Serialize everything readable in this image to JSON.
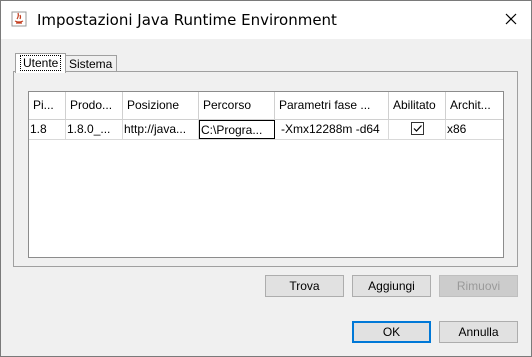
{
  "window": {
    "title": "Impostazioni Java Runtime Environment"
  },
  "tabs": [
    {
      "label": "Utente",
      "active": true
    },
    {
      "label": "Sistema",
      "active": false
    }
  ],
  "table": {
    "columns": [
      "Pi...",
      "Prodo...",
      "Posizione",
      "Percorso",
      "Parametri fase ...",
      "Abilitato",
      "Archit..."
    ],
    "rows": [
      {
        "cells": [
          "1.8",
          "1.8.0_...",
          "http://java...",
          "C:\\Progra...",
          "-Xmx12288m -d64",
          "",
          "x86"
        ],
        "enabled": true
      }
    ]
  },
  "buttons": {
    "find": "Trova",
    "add": "Aggiungi",
    "remove": "Rimuovi",
    "ok": "OK",
    "cancel": "Annulla"
  },
  "colors": {
    "accent": "#0078d7"
  }
}
